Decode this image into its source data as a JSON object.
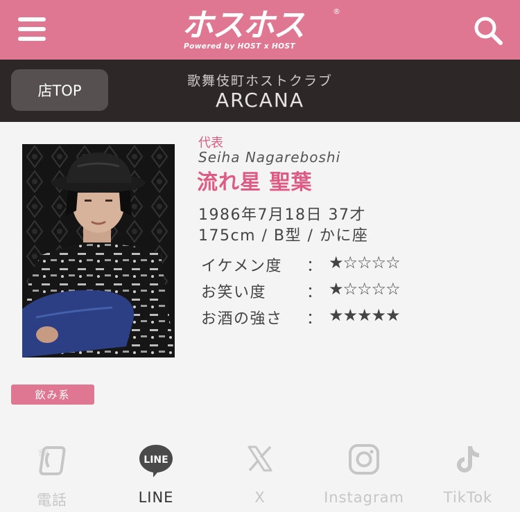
{
  "header": {
    "logo_main": "ホスホス",
    "logo_sub": "Powered by HOST x HOST",
    "logo_reg": "®"
  },
  "shop": {
    "top_button": "店TOP",
    "area": "歌舞伎町ホストクラブ",
    "name": "ARCANA"
  },
  "profile": {
    "position": "代表",
    "romaji": "Seiha Nagareboshi",
    "name": "流れ星 聖葉",
    "birth": "1986年7月18日 37才",
    "body": "175cm / B型 / かに座",
    "ratings": [
      {
        "label": "イケメン度",
        "colon": "：",
        "stars": "★☆☆☆☆",
        "value": 1
      },
      {
        "label": "お笑い度",
        "colon": "：",
        "stars": "★☆☆☆☆",
        "value": 1
      },
      {
        "label": "お酒の強さ",
        "colon": "：",
        "stars": "★★★★★",
        "value": 5
      }
    ],
    "tag": "飲み系"
  },
  "social": [
    {
      "label": "電話",
      "icon": "phone-icon",
      "active": false
    },
    {
      "label": "LINE",
      "icon": "line-icon",
      "active": true
    },
    {
      "label": "X",
      "icon": "x-icon",
      "active": false
    },
    {
      "label": "Instagram",
      "icon": "instagram-icon",
      "active": false
    },
    {
      "label": "TikTok",
      "icon": "tiktok-icon",
      "active": false
    }
  ],
  "colors": {
    "brand_pink": "#df7792",
    "dark_bar": "#2e2727",
    "name_pink": "#df5b85"
  }
}
